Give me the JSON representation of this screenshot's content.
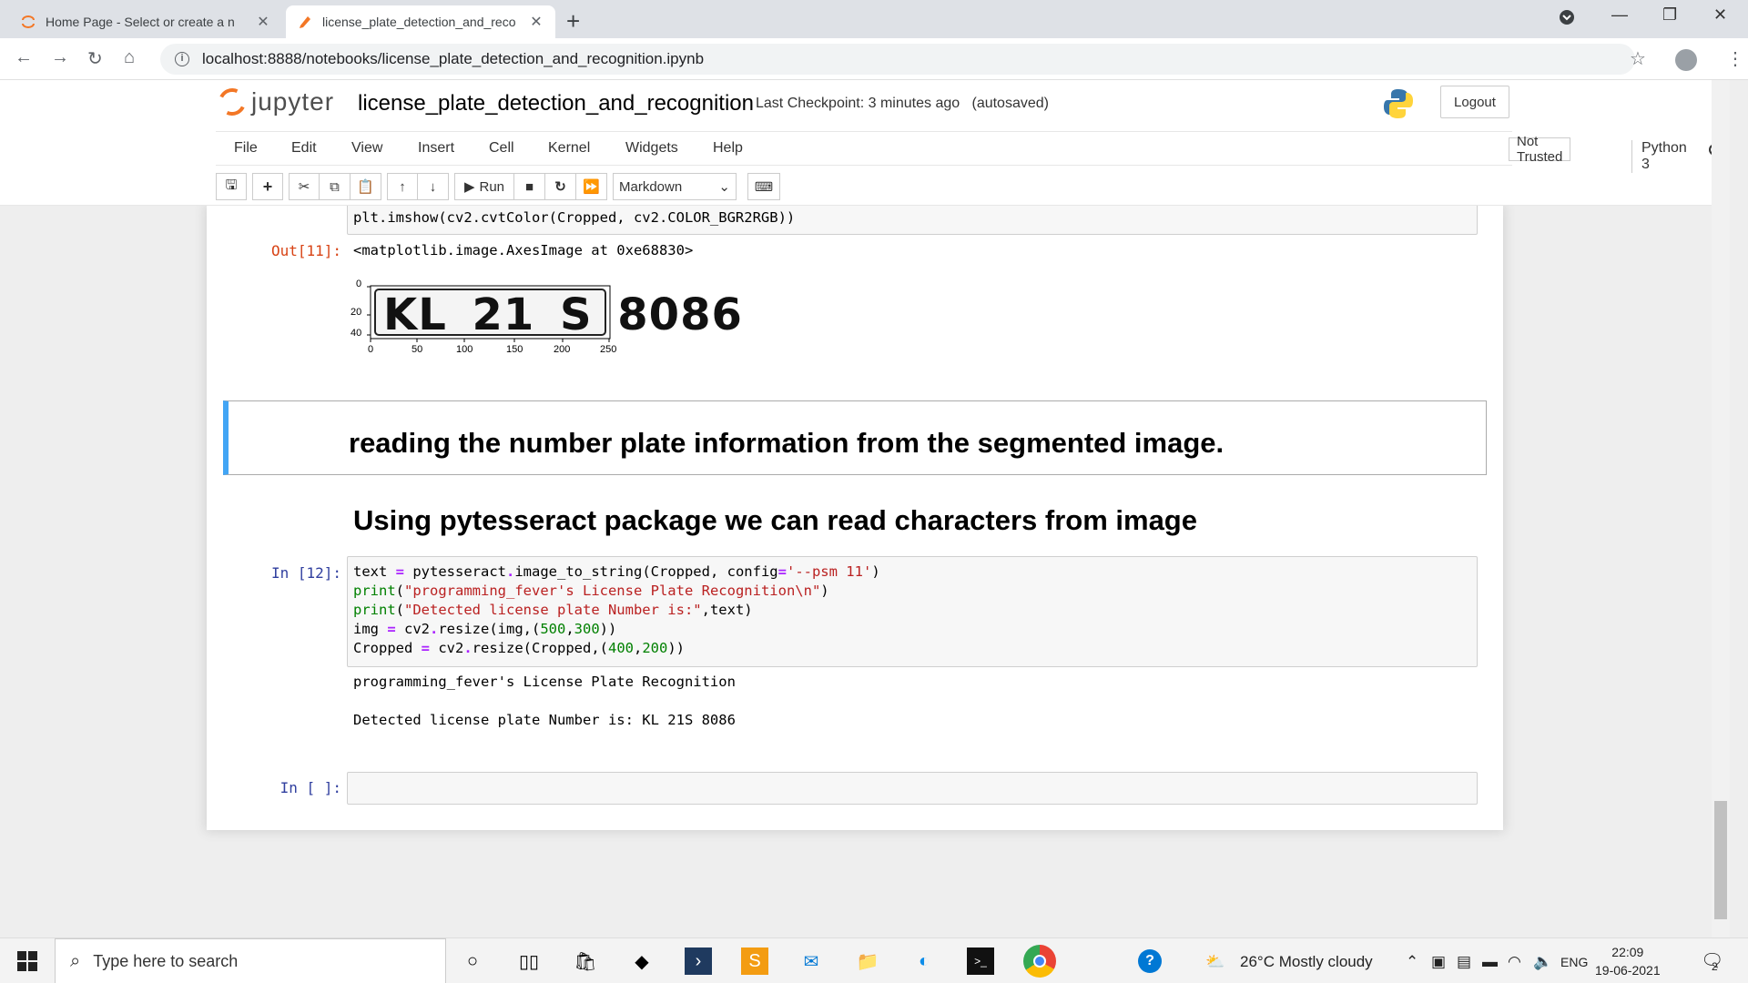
{
  "browser": {
    "tabs": [
      {
        "title": "Home Page - Select or create a n",
        "active": false
      },
      {
        "title": "license_plate_detection_and_reco",
        "active": true
      }
    ],
    "new_tab": "+",
    "url": "localhost:8888/notebooks/license_plate_detection_and_recognition.ipynb"
  },
  "jupyter": {
    "logo_text": "jupyter",
    "notebook_name": "license_plate_detection_and_recognition",
    "checkpoint": "Last Checkpoint: 3 minutes ago",
    "autosaved": "(autosaved)",
    "logout": "Logout",
    "menu": [
      "File",
      "Edit",
      "View",
      "Insert",
      "Cell",
      "Kernel",
      "Widgets",
      "Help"
    ],
    "not_trusted": "Not Trusted",
    "kernel": "Python 3",
    "run_label": "Run",
    "cell_type": "Markdown"
  },
  "cells": {
    "partial_code_line": "plt.imshow(cv2.cvtColor(Cropped, cv2.COLOR_BGR2RGB))",
    "out11_prompt": "Out[11]:",
    "out11_text": "<matplotlib.image.AxesImage at 0xe68830>",
    "plate_text": "KL 21 S 8086",
    "plot_yticks": [
      "0",
      "20",
      "40"
    ],
    "plot_xticks": [
      "0",
      "50",
      "100",
      "150",
      "200",
      "250"
    ],
    "md_heading": "reading the number plate information from the segmented image.",
    "md_heading2": "Using pytesseract package we can read characters from image",
    "in12_prompt": "In [12]:",
    "in12_output_line1": "programming_fever's License Plate Recognition",
    "in12_output_line2": "Detected license plate Number is: KL 21S 8086",
    "empty_prompt": "In [ ]:"
  },
  "taskbar": {
    "search_placeholder": "Type here to search",
    "weather": "26°C  Mostly cloudy",
    "lang": "ENG",
    "time": "22:09",
    "date": "19-06-2021",
    "notif_count": "2"
  },
  "colors": {
    "jupyter_orange": "#f37726",
    "md_border": "#42a5f5",
    "in_prompt": "#303f9f",
    "out_prompt": "#d84315"
  }
}
